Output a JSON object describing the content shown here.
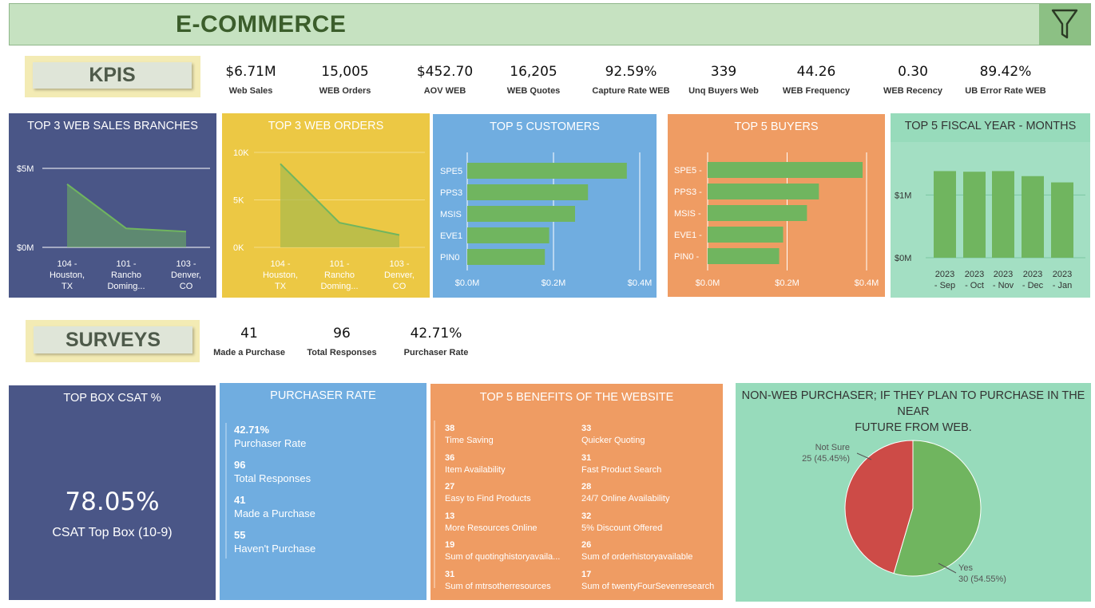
{
  "header": {
    "title": "E-COMMERCE",
    "filter_icon": "funnel-icon"
  },
  "colors": {
    "navy": "#4a5687",
    "yellow": "#ecc844",
    "blue": "#70ade0",
    "orange": "#ef9c63",
    "mint": "#97dbbb",
    "green": "#70b55f",
    "red": "#cd4b47"
  },
  "kpis_section": {
    "label": "KPIS"
  },
  "kpis": [
    {
      "value": "$6.71M",
      "label": "Web Sales"
    },
    {
      "value": "15,005",
      "label": "WEB Orders"
    },
    {
      "value": "$452.70",
      "label": "AOV WEB"
    },
    {
      "value": "16,205",
      "label": "WEB Quotes"
    },
    {
      "value": "92.59%",
      "label": "Capture Rate WEB"
    },
    {
      "value": "339",
      "label": "Unq Buyers Web"
    },
    {
      "value": "44.26",
      "label": "WEB Frequency"
    },
    {
      "value": "0.30",
      "label": "WEB Recency"
    },
    {
      "value": "89.42%",
      "label": "UB Error Rate WEB"
    }
  ],
  "cards": {
    "sales_branches": {
      "title": "TOP 3 WEB SALES BRANCHES"
    },
    "web_orders": {
      "title": "TOP 3 WEB ORDERS"
    },
    "customers": {
      "title": "TOP 5 CUSTOMERS"
    },
    "buyers": {
      "title": "TOP 5 BUYERS"
    },
    "fiscal": {
      "title": "TOP 5 FISCAL YEAR - MONTHS"
    }
  },
  "surveys_section": {
    "label": "SURVEYS"
  },
  "survey_kpis": [
    {
      "value": "41",
      "label": "Made a Purchase"
    },
    {
      "value": "96",
      "label": "Total Responses"
    },
    {
      "value": "42.71%",
      "label": "Purchaser Rate"
    }
  ],
  "csat": {
    "title": "TOP BOX CSAT %",
    "value": "78.05%",
    "label": "CSAT Top Box (10-9)"
  },
  "purchaser_rate": {
    "title": "PURCHASER RATE",
    "stats": [
      {
        "num": "42.71%",
        "label": "Purchaser Rate"
      },
      {
        "num": "96",
        "label": "Total Responses"
      },
      {
        "num": "41",
        "label": "Made a Purchase"
      },
      {
        "num": "55",
        "label": "Haven't Purchase"
      }
    ]
  },
  "benefits": {
    "title": "TOP 5 BENEFITS OF THE WEBSITE",
    "items": [
      {
        "num": "38",
        "label": "Time Saving"
      },
      {
        "num": "33",
        "label": "Quicker Quoting"
      },
      {
        "num": "36",
        "label": "Item Availability"
      },
      {
        "num": "31",
        "label": "Fast Product Search"
      },
      {
        "num": "27",
        "label": "Easy to Find Products"
      },
      {
        "num": "28",
        "label": "24/7 Online Availability"
      },
      {
        "num": "13",
        "label": "More Resources Online"
      },
      {
        "num": "32",
        "label": "5% Discount Offered"
      },
      {
        "num": "19",
        "label": "Sum of quotinghistoryavaila..."
      },
      {
        "num": "26",
        "label": "Sum of orderhistoryavailable"
      },
      {
        "num": "31",
        "label": "Sum of mtrsotherresources"
      },
      {
        "num": "17",
        "label": "Sum of twentyFourSevenresearch"
      }
    ]
  },
  "nonweb": {
    "title_line1": "NON-WEB PURCHASER; IF THEY PLAN TO PURCHASE IN THE NEAR",
    "title_line2": "FUTURE FROM WEB."
  },
  "chart_data": [
    {
      "type": "area",
      "title": "TOP 3 WEB SALES BRANCHES",
      "categories": [
        [
          "104 -",
          "Houston,",
          "TX"
        ],
        [
          "101 -",
          "Rancho",
          "Doming..."
        ],
        [
          "103 -",
          "Denver,",
          "CO"
        ]
      ],
      "values": [
        4.0,
        1.2,
        1.0
      ],
      "yticks": [
        "$0M",
        "$5M"
      ],
      "ylim": [
        0,
        5
      ]
    },
    {
      "type": "area",
      "title": "TOP 3 WEB ORDERS",
      "categories": [
        [
          "104 -",
          "Houston,",
          "TX"
        ],
        [
          "101 -",
          "Rancho",
          "Doming..."
        ],
        [
          "103 -",
          "Denver,",
          "CO"
        ]
      ],
      "values": [
        8800,
        2600,
        1300
      ],
      "yticks": [
        "0K",
        "5K",
        "10K"
      ],
      "ylim": [
        0,
        10000
      ]
    },
    {
      "type": "bar",
      "title": "TOP 5 CUSTOMERS",
      "categories": [
        "SPE5",
        "PPS3",
        "MSIS",
        "EVE1",
        "PIN0"
      ],
      "values": [
        0.37,
        0.28,
        0.25,
        0.19,
        0.18
      ],
      "xticks": [
        "$0.0M",
        "$0.2M",
        "$0.4M"
      ],
      "xlim": [
        0,
        0.4
      ]
    },
    {
      "type": "bar",
      "title": "TOP 5 BUYERS",
      "categories": [
        "SPE5 -",
        "PPS3 -",
        "MSIS -",
        "EVE1 -",
        "PIN0 -"
      ],
      "values": [
        0.39,
        0.28,
        0.25,
        0.19,
        0.18
      ],
      "xticks": [
        "$0.0M",
        "$0.2M",
        "$0.4M"
      ],
      "xlim": [
        0,
        0.4
      ]
    },
    {
      "type": "bar",
      "title": "TOP 5 FISCAL YEAR - MONTHS",
      "categories": [
        [
          "2023",
          "- Sep"
        ],
        [
          "2023",
          "- Oct"
        ],
        [
          "2023",
          "- Nov"
        ],
        [
          "2023",
          "- Dec"
        ],
        [
          "2023",
          "- Jan"
        ]
      ],
      "values": [
        1.38,
        1.37,
        1.38,
        1.3,
        1.2
      ],
      "yticks": [
        "$0M",
        "$1M"
      ],
      "ylim": [
        0,
        1.5
      ]
    },
    {
      "type": "pie",
      "title": "NON-WEB PURCHASER; IF THEY PLAN TO PURCHASE IN THE NEAR FUTURE FROM WEB.",
      "slices": [
        {
          "name": "Yes",
          "value": 30,
          "label": "30 (54.55%)",
          "color": "#70b55f"
        },
        {
          "name": "Not Sure",
          "value": 25,
          "label": "25 (45.45%)",
          "color": "#cd4b47"
        }
      ]
    }
  ]
}
